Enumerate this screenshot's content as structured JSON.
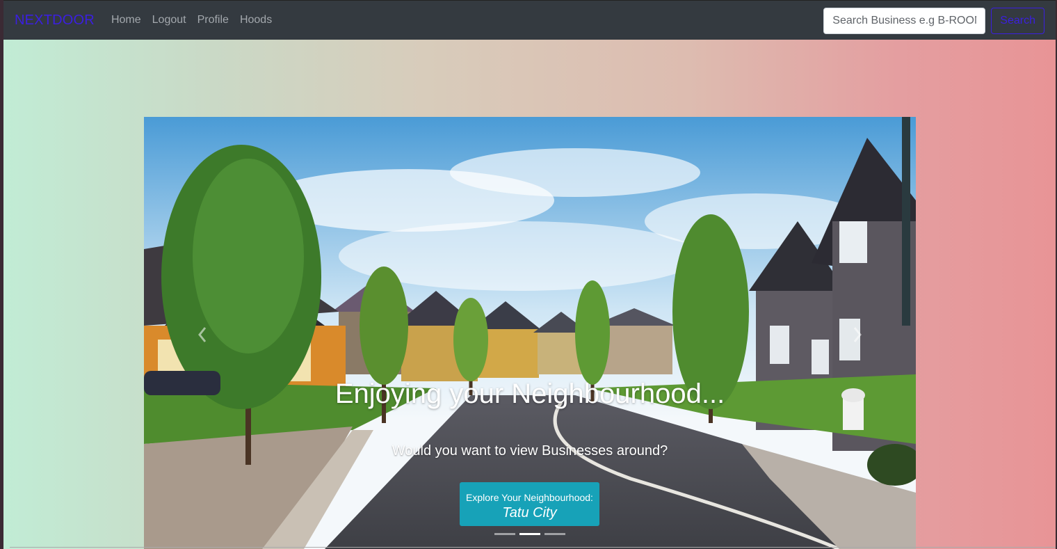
{
  "navbar": {
    "brand": "NEXTDOOR",
    "links": [
      "Home",
      "Logout",
      "Profile",
      "Hoods"
    ],
    "search": {
      "placeholder": "Search Business e.g B-ROOM",
      "button_label": "Search"
    }
  },
  "carousel": {
    "title": "Enjoying your Neighbourhood...",
    "subtitle": "Would you want to view Businesses around?",
    "explore_label": "Explore Your Neighbourhood:",
    "explore_city": "Tatu City",
    "active_slide": 1,
    "slide_count": 3
  },
  "colors": {
    "navbar_bg": "#343a40",
    "brand": "#3b1fe0",
    "explore_button": "#17a2b8"
  },
  "icons": [
    "prev-chevron-icon",
    "next-chevron-icon"
  ]
}
